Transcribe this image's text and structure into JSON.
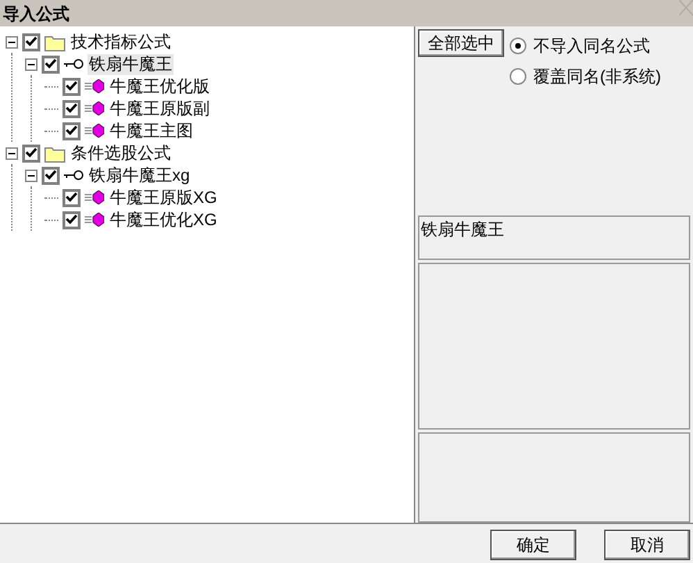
{
  "window": {
    "title": "导入公式"
  },
  "tree": [
    {
      "kind": "folder",
      "label": "技术指标公式",
      "checked": true,
      "expanded": true,
      "selected": false,
      "children": [
        {
          "kind": "formula",
          "label": "铁扇牛魔王",
          "checked": true,
          "expanded": true,
          "selected": true,
          "children": [
            {
              "kind": "item",
              "label": "牛魔王优化版",
              "checked": true,
              "selected": false
            },
            {
              "kind": "item",
              "label": "牛魔王原版副",
              "checked": true,
              "selected": false
            },
            {
              "kind": "item",
              "label": "牛魔王主图",
              "checked": true,
              "selected": false
            }
          ]
        }
      ]
    },
    {
      "kind": "folder",
      "label": "条件选股公式",
      "checked": true,
      "expanded": true,
      "selected": false,
      "children": [
        {
          "kind": "formula",
          "label": "铁扇牛魔王xg",
          "checked": true,
          "expanded": true,
          "selected": false,
          "children": [
            {
              "kind": "item",
              "label": "牛魔王原版XG",
              "checked": true,
              "selected": false
            },
            {
              "kind": "item",
              "label": "牛魔王优化XG",
              "checked": true,
              "selected": false
            }
          ]
        }
      ]
    }
  ],
  "select_all_button": "全部选中",
  "options": [
    {
      "label": "不导入同名公式",
      "selected": true
    },
    {
      "label": "覆盖同名(非系统)",
      "selected": false
    }
  ],
  "name_box": "铁扇牛魔王",
  "buttons": [
    "确定",
    "取消"
  ]
}
